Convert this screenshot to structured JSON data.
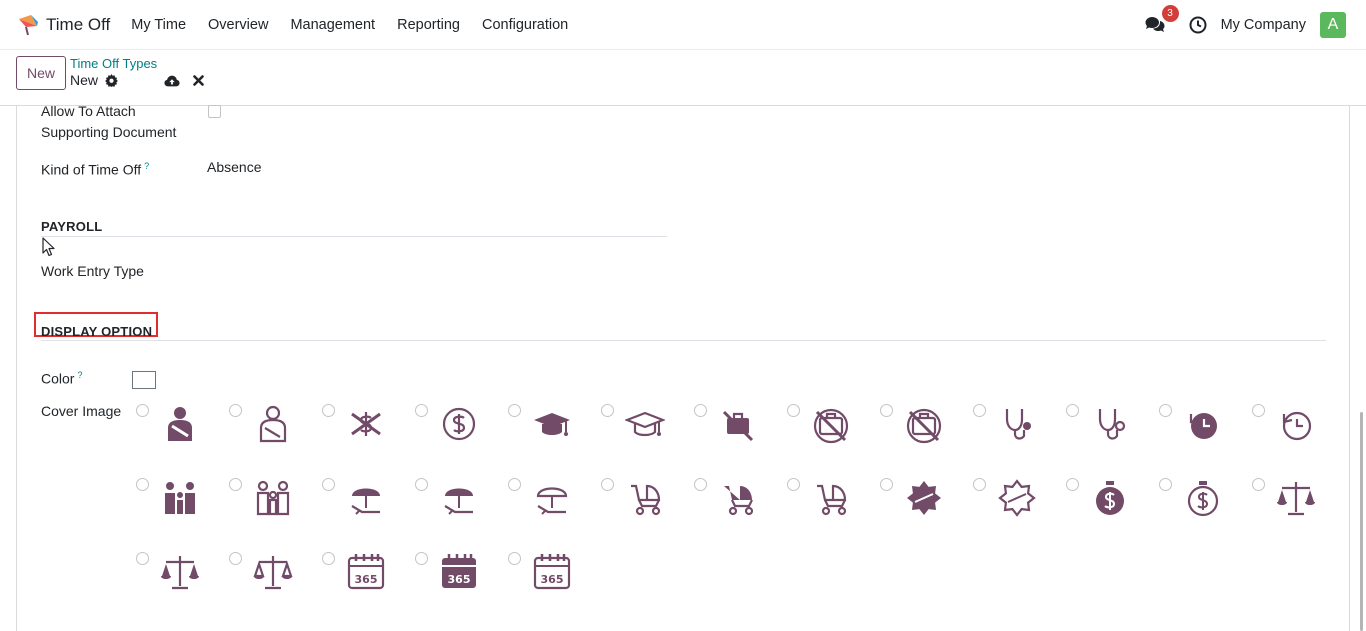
{
  "app": {
    "name": "Time Off"
  },
  "nav": {
    "items": [
      "My Time",
      "Overview",
      "Management",
      "Reporting",
      "Configuration"
    ]
  },
  "systray": {
    "chat_count": "3",
    "company": "My Company",
    "avatar_letter": "A"
  },
  "control": {
    "new_label": "New",
    "breadcrumb": "Time Off Types",
    "record_name": "New"
  },
  "form": {
    "attach_label_1": "Allow To Attach",
    "attach_label_2": "Supporting Document",
    "kind_label": "Kind of Time Off",
    "kind_help": "?",
    "kind_value": "Absence",
    "payroll_title": "PAYROLL",
    "work_entry_label": "Work Entry Type",
    "display_title": "DISPLAY OPTION",
    "color_label": "Color",
    "color_help": "?",
    "cover_label": "Cover Image"
  },
  "colors": {
    "accent": "#714b67",
    "icon": "#714b67",
    "link": "#017e84",
    "badge": "#d23f3a",
    "avatar": "#5cb85c",
    "highlight": "#e02d2d"
  },
  "cover_images": [
    {
      "icon": "injured-person-filled-icon"
    },
    {
      "icon": "injured-person-outline-icon"
    },
    {
      "icon": "no-money-icon"
    },
    {
      "icon": "money-circle-outline-icon"
    },
    {
      "icon": "graduation-cap-filled-icon"
    },
    {
      "icon": "graduation-cap-outline-icon"
    },
    {
      "icon": "no-briefcase-icon"
    },
    {
      "icon": "no-briefcase-circle-filled-icon"
    },
    {
      "icon": "no-briefcase-circle-outline-icon"
    },
    {
      "icon": "stethoscope-filled-icon"
    },
    {
      "icon": "stethoscope-outline-icon"
    },
    {
      "icon": "clock-rewind-filled-icon"
    },
    {
      "icon": "clock-rewind-outline-icon"
    },
    {
      "icon": "family-filled-icon"
    },
    {
      "icon": "family-outline-icon"
    },
    {
      "icon": "beach-umbrella-filled-icon"
    },
    {
      "icon": "beach-umbrella-chair-icon"
    },
    {
      "icon": "beach-umbrella-outline-icon"
    },
    {
      "icon": "baby-stroller-icon"
    },
    {
      "icon": "baby-stroller-filled-icon"
    },
    {
      "icon": "baby-stroller-outline-icon"
    },
    {
      "icon": "extra-badge-filled-icon"
    },
    {
      "icon": "extra-badge-outline-icon"
    },
    {
      "icon": "stopwatch-dollar-filled-icon"
    },
    {
      "icon": "stopwatch-dollar-outline-icon"
    },
    {
      "icon": "balance-scale-icon"
    },
    {
      "icon": "balance-scale-filled-icon"
    },
    {
      "icon": "balance-scale-outline-icon"
    },
    {
      "icon": "calendar-365-icon"
    },
    {
      "icon": "calendar-365-filled-icon"
    },
    {
      "icon": "calendar-365-outline-icon"
    }
  ]
}
